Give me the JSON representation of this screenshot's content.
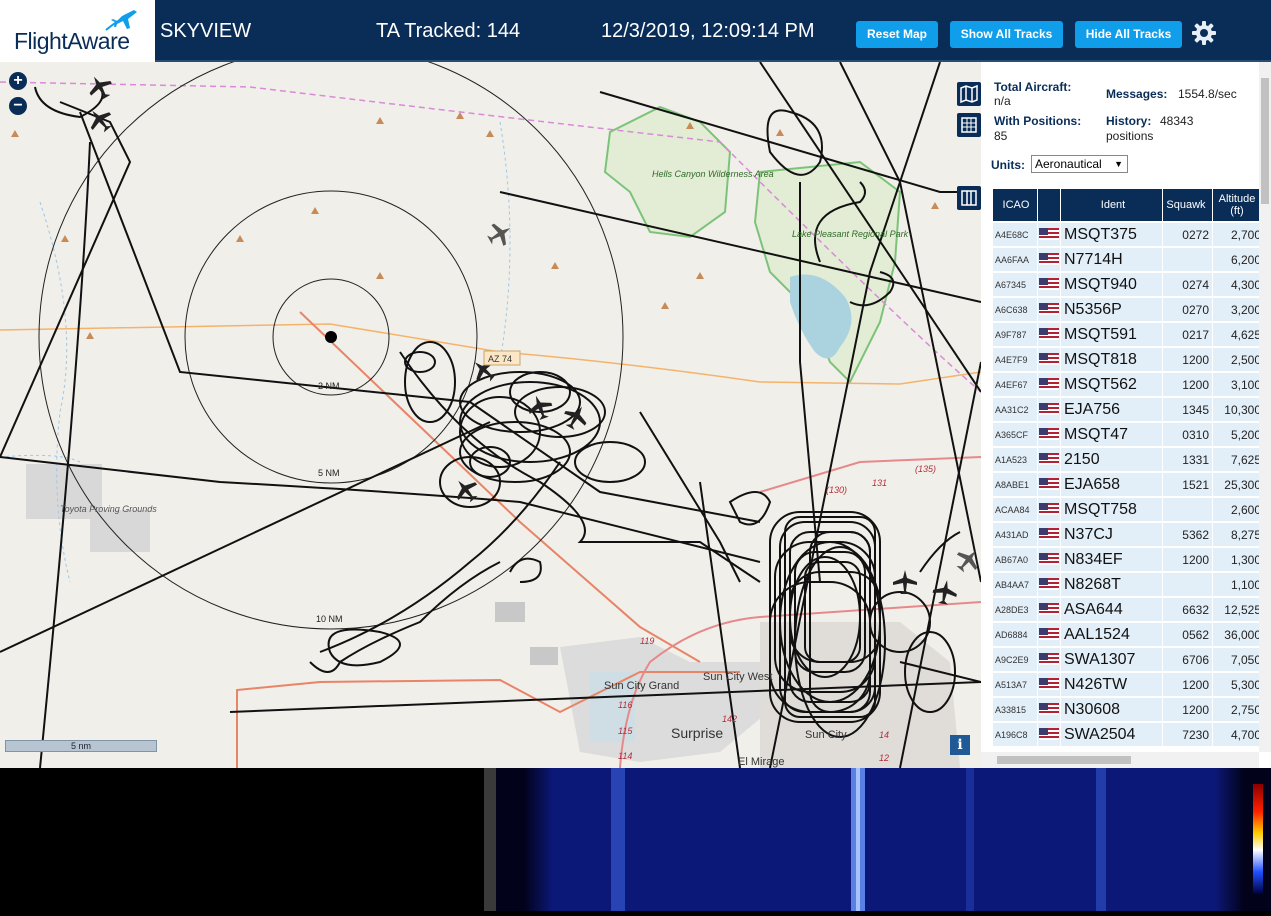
{
  "header": {
    "logo_text": "FlightAware",
    "app_name": "SKYVIEW",
    "tracked_label": "TA Tracked: 144",
    "datetime": "12/3/2019, 12:09:14 PM",
    "reset_map": "Reset Map",
    "show_all_tracks": "Show All Tracks",
    "hide_all_tracks": "Hide All Tracks",
    "settings_icon": "gear-icon"
  },
  "map": {
    "zoom_in": "+",
    "zoom_out": "−",
    "range_rings": [
      "2 NM",
      "5 NM",
      "10 NM"
    ],
    "scale": "5 nm",
    "info": "i",
    "places": {
      "hells_canyon": "Hells Canyon Wilderness Area",
      "lake_pleasant": "Lake Pleasant Regional Park",
      "toyota": "Toyota Proving Grounds",
      "sun_city_grand": "Sun City Grand",
      "sun_city_west": "Sun City West",
      "surprise": "Surprise",
      "el_mirage": "El Mirage",
      "sun_city": "Sun City",
      "az74": "AZ 74"
    },
    "road_labels": [
      "(130)",
      "131",
      "(135)",
      "119",
      "116",
      "115",
      "114",
      "142",
      "14",
      "12"
    ]
  },
  "sidebar": {
    "total_aircraft_label": "Total Aircraft:",
    "total_aircraft_value": "n/a",
    "with_positions_label": "With Positions:",
    "with_positions_value": "85",
    "messages_label": "Messages:",
    "messages_value": "1554.8/sec",
    "history_label": "History:",
    "history_value": "48343",
    "history_unit": "positions",
    "units_label": "Units:",
    "units_value": "Aeronautical",
    "columns": {
      "icao": "ICAO",
      "ident": "Ident",
      "squawk": "Squawk",
      "altitude": "Altitude",
      "altitude_unit": "(ft)"
    },
    "rows": [
      {
        "icao": "A4E68C",
        "ident": "MSQT375",
        "squawk": "0272",
        "alt": "2,700"
      },
      {
        "icao": "AA6FAA",
        "ident": "N7714H",
        "squawk": "",
        "alt": "6,200"
      },
      {
        "icao": "A67345",
        "ident": "MSQT940",
        "squawk": "0274",
        "alt": "4,300"
      },
      {
        "icao": "A6C638",
        "ident": "N5356P",
        "squawk": "0270",
        "alt": "3,200"
      },
      {
        "icao": "A9F787",
        "ident": "MSQT591",
        "squawk": "0217",
        "alt": "4,625"
      },
      {
        "icao": "A4E7F9",
        "ident": "MSQT818",
        "squawk": "1200",
        "alt": "2,500"
      },
      {
        "icao": "A4EF67",
        "ident": "MSQT562",
        "squawk": "1200",
        "alt": "3,100"
      },
      {
        "icao": "AA31C2",
        "ident": "EJA756",
        "squawk": "1345",
        "alt": "10,300"
      },
      {
        "icao": "A365CF",
        "ident": "MSQT47",
        "squawk": "0310",
        "alt": "5,200"
      },
      {
        "icao": "A1A523",
        "ident": "2150",
        "squawk": "1331",
        "alt": "7,625"
      },
      {
        "icao": "A8ABE1",
        "ident": "EJA658",
        "squawk": "1521",
        "alt": "25,300"
      },
      {
        "icao": "ACAA84",
        "ident": "MSQT758",
        "squawk": "",
        "alt": "2,600"
      },
      {
        "icao": "A431AD",
        "ident": "N37CJ",
        "squawk": "5362",
        "alt": "8,275"
      },
      {
        "icao": "AB67A0",
        "ident": "N834EF",
        "squawk": "1200",
        "alt": "1,300"
      },
      {
        "icao": "AB4AA7",
        "ident": "N8268T",
        "squawk": "",
        "alt": "1,100"
      },
      {
        "icao": "A28DE3",
        "ident": "ASA644",
        "squawk": "6632",
        "alt": "12,525"
      },
      {
        "icao": "AD6884",
        "ident": "AAL1524",
        "squawk": "0562",
        "alt": "36,000"
      },
      {
        "icao": "A9C2E9",
        "ident": "SWA1307",
        "squawk": "6706",
        "alt": "7,050"
      },
      {
        "icao": "A513A7",
        "ident": "N426TW",
        "squawk": "1200",
        "alt": "5,300"
      },
      {
        "icao": "A33815",
        "ident": "N30608",
        "squawk": "1200",
        "alt": "2,750"
      },
      {
        "icao": "A196C8",
        "ident": "SWA2504",
        "squawk": "7230",
        "alt": "4,700"
      }
    ]
  }
}
